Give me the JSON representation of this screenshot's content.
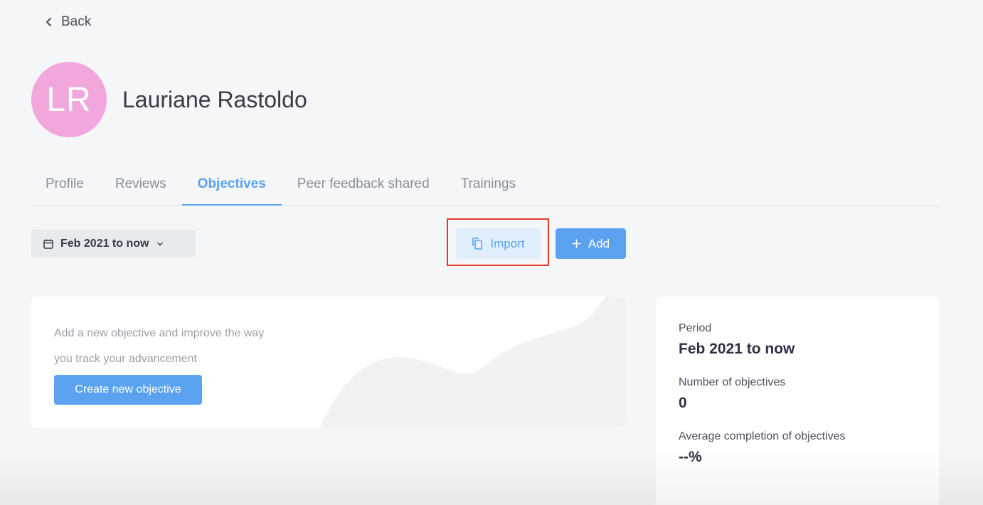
{
  "nav": {
    "back_label": "Back"
  },
  "employee": {
    "initials": "LR",
    "name": "Lauriane Rastoldo",
    "avatar_color": "#f1a7dc"
  },
  "tabs": [
    {
      "label": "Profile",
      "active": false
    },
    {
      "label": "Reviews",
      "active": false
    },
    {
      "label": "Objectives",
      "active": true
    },
    {
      "label": "Peer feedback shared",
      "active": false
    },
    {
      "label": "Trainings",
      "active": false
    }
  ],
  "toolbar": {
    "period_label": "Feb 2021 to now",
    "import_label": "Import",
    "add_label": "Add",
    "accent_color": "#5aa2f0",
    "highlight_color": "#e23b2e"
  },
  "empty_state": {
    "line1": "Add a new objective and improve the way",
    "line2": "you track your advancement",
    "create_label": "Create new objective"
  },
  "stats": {
    "period_label": "Period",
    "period_value": "Feb 2021 to now",
    "count_label": "Number of objectives",
    "count_value": "0",
    "avg_label": "Average completion of objectives",
    "avg_value": "--%"
  }
}
